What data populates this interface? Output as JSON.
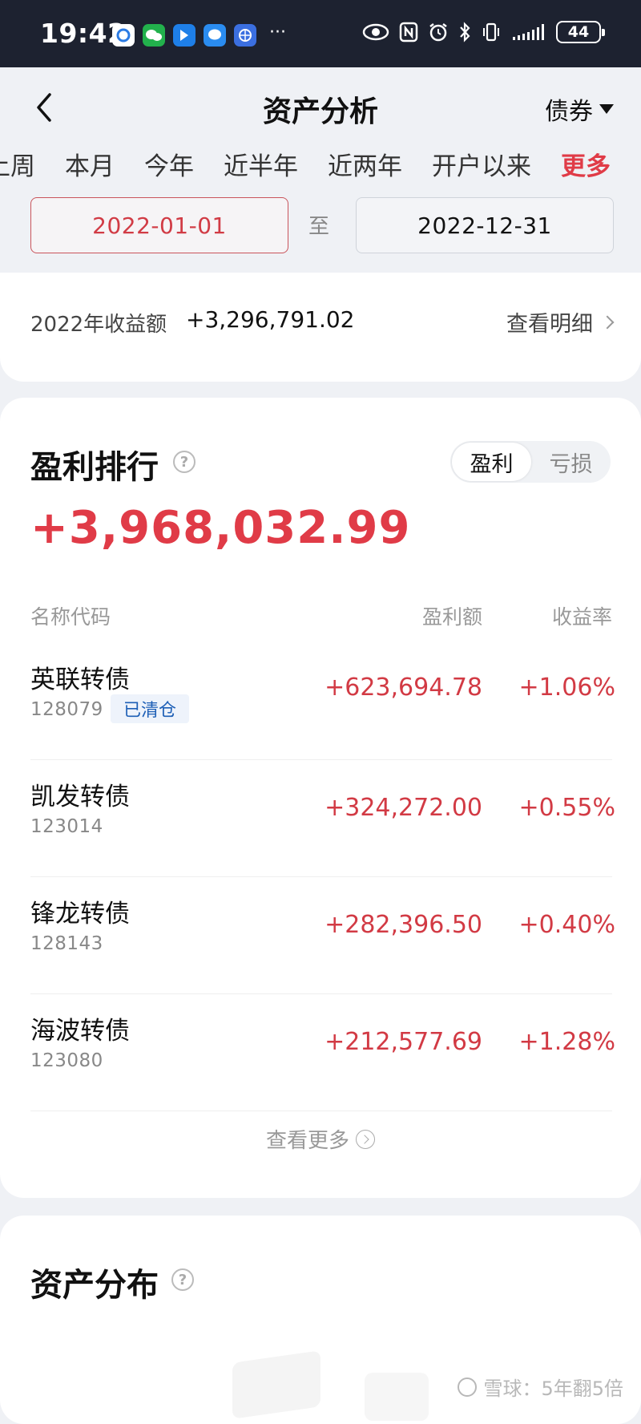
{
  "status_bar": {
    "time": "19:42",
    "battery": "44",
    "app_icons": [
      "app-icon-1",
      "wechat-icon",
      "app-icon-3",
      "message-icon",
      "browser-icon"
    ],
    "system_icons": [
      "eye-icon",
      "nfc-icon",
      "alarm-icon",
      "bluetooth-icon",
      "vibrate-icon",
      "signal-icon"
    ]
  },
  "header": {
    "title": "资产分析",
    "category": "债券"
  },
  "period_tabs": [
    {
      "label": "上周",
      "active": false
    },
    {
      "label": "本月",
      "active": false
    },
    {
      "label": "今年",
      "active": false
    },
    {
      "label": "近半年",
      "active": false
    },
    {
      "label": "近两年",
      "active": false
    },
    {
      "label": "开户以来",
      "active": false
    },
    {
      "label": "更多",
      "active": true
    }
  ],
  "date_range": {
    "start": "2022-01-01",
    "separator": "至",
    "end": "2022-12-31"
  },
  "summary": {
    "label": "2022年收益额",
    "value": "+3,296,791.02",
    "detail_link": "查看明细"
  },
  "ranking": {
    "title": "盈利排行",
    "toggle": {
      "profit": "盈利",
      "loss": "亏损",
      "selected": "盈利"
    },
    "total": "+3,968,032.99",
    "columns": {
      "name": "名称代码",
      "profit": "盈利额",
      "rate": "收益率"
    },
    "rows": [
      {
        "name": "英联转债",
        "code": "128079",
        "tag": "已清仓",
        "profit": "+623,694.78",
        "rate": "+1.06%"
      },
      {
        "name": "凯发转债",
        "code": "123014",
        "tag": "",
        "profit": "+324,272.00",
        "rate": "+0.55%"
      },
      {
        "name": "锋龙转债",
        "code": "128143",
        "tag": "",
        "profit": "+282,396.50",
        "rate": "+0.40%"
      },
      {
        "name": "海波转债",
        "code": "123080",
        "tag": "",
        "profit": "+212,577.69",
        "rate": "+1.28%"
      }
    ],
    "view_more": "查看更多"
  },
  "asset_distribution": {
    "title": "资产分布"
  },
  "watermark": "雪球：5年翻5倍",
  "colors": {
    "accent_red": "#e03b47",
    "tag_blue": "#1d5fb6",
    "status_bar_bg": "#1d2230"
  }
}
